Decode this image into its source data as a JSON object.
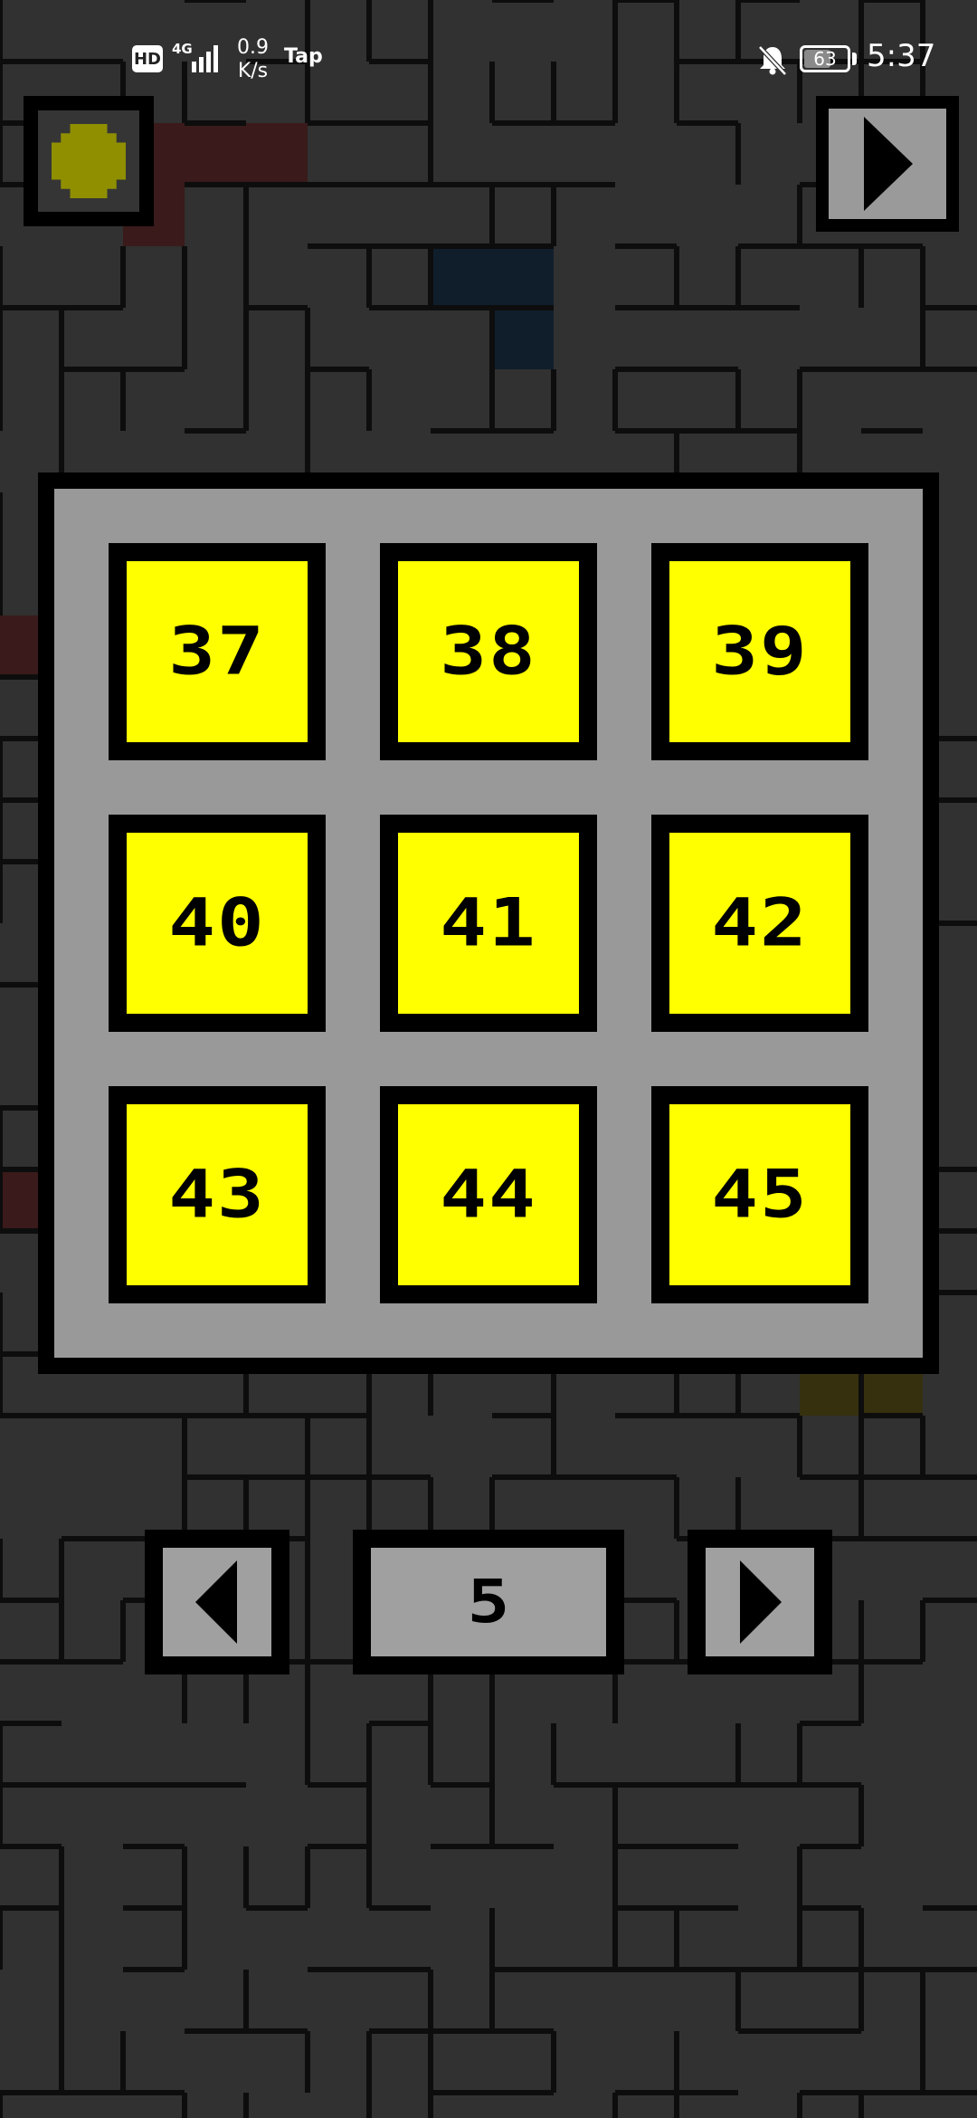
{
  "status_bar": {
    "hd_badge": "HD",
    "network_type": "4G",
    "net_speed_value": "0.9",
    "net_speed_unit": "K/s",
    "app_label": "Tap",
    "battery_level": "63",
    "time": "5:37"
  },
  "top_bar": {
    "left_icon": "yellow-coin-icon",
    "right_icon": "play-right-arrow-icon"
  },
  "level_grid": {
    "levels": [
      {
        "number": "37"
      },
      {
        "number": "38"
      },
      {
        "number": "39"
      },
      {
        "number": "40"
      },
      {
        "number": "41"
      },
      {
        "number": "42"
      },
      {
        "number": "43"
      },
      {
        "number": "44"
      },
      {
        "number": "45"
      }
    ]
  },
  "pager": {
    "current_page": "5",
    "prev_icon": "left-arrow-icon",
    "next_icon": "right-arrow-icon"
  },
  "colors": {
    "background": "#313131",
    "panel": "#999999",
    "tile": "#ffff00",
    "coin": "#8f8f00",
    "button_face": "#9a9a9a",
    "accent_red": "#3a1a1a",
    "accent_blue": "#101e2c",
    "accent_olive": "#36300e"
  }
}
